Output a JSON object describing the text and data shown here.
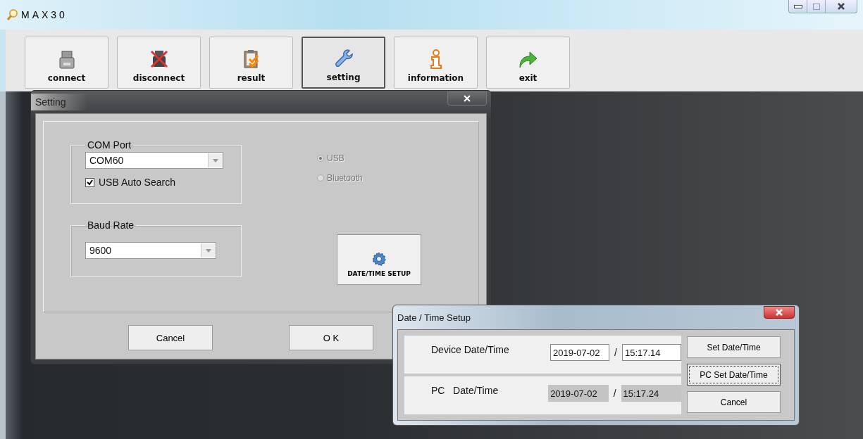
{
  "window": {
    "title": "MAX30"
  },
  "toolbar": {
    "buttons": [
      {
        "label": "connect",
        "selected": false
      },
      {
        "label": "disconnect",
        "selected": false
      },
      {
        "label": "result",
        "selected": false
      },
      {
        "label": "setting",
        "selected": true
      },
      {
        "label": "information",
        "selected": false
      },
      {
        "label": "exit",
        "selected": false
      }
    ]
  },
  "setting_dialog": {
    "title": "Setting",
    "com_port": {
      "legend": "COM Port",
      "value": "COM60",
      "auto_search": {
        "label": "USB Auto Search",
        "checked": true
      }
    },
    "baud_rate": {
      "legend": "Baud Rate",
      "value": "9600"
    },
    "connection": [
      {
        "label": "USB",
        "selected": true,
        "disabled": true
      },
      {
        "label": "Bluetooth",
        "selected": false,
        "disabled": true
      }
    ],
    "date_time_button": "DATE/TIME SETUP",
    "buttons": [
      "Cancel",
      "O K"
    ]
  },
  "datetime_dialog": {
    "title": "Date / Time Setup",
    "rows": [
      {
        "label": "Device Date/Time",
        "date": "2019-07-02",
        "separator": "/",
        "time": "15:17.14",
        "editable": true
      },
      {
        "label": "PC   Date/Time",
        "date": "2019-07-02",
        "separator": "/",
        "time": "15:17.24",
        "editable": false
      }
    ],
    "buttons": [
      {
        "label": "Set Date/Time",
        "focused": false
      },
      {
        "label": "PC Set Date/Time",
        "focused": true
      },
      {
        "label": "Cancel",
        "focused": false
      }
    ]
  }
}
